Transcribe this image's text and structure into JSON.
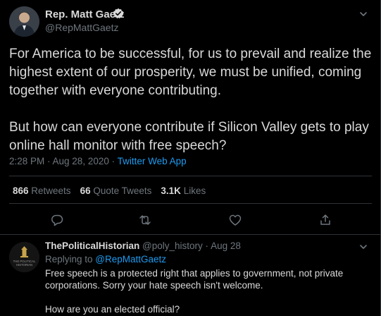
{
  "tweet": {
    "author_name": "Rep. Matt Gaetz",
    "author_handle": "@RepMattGaetz",
    "paragraphs": [
      "For America to be successful, for us to prevail and realize the highest extent of our prosperity, we must be unified, coming together with everyone contributing.",
      "But how can everyone contribute if Silicon Valley gets to play online hall monitor with free speech?"
    ],
    "timestamp": "2:28 PM · Aug 28, 2020 · ",
    "source": "Twitter Web App",
    "stats": {
      "retweets_count": "866",
      "retweets_label": " Retweets",
      "quotes_count": "66",
      "quotes_label": " Quote Tweets",
      "likes_count": "3.1K",
      "likes_label": " Likes"
    }
  },
  "reply": {
    "author_name": "ThePoliticalHistorian",
    "author_handle": "@poly_history",
    "date": "Aug 28",
    "replying_prefix": "Replying to ",
    "replying_to": "@RepMattGaetz",
    "avatar_text": "THE POLITICAL HISTORIAN",
    "paragraphs": [
      "Free speech is a protected right that applies to government, not private corporations. Sorry your hate speech isn't welcome.",
      "How are you an elected official?"
    ]
  },
  "icons": {
    "verified": "verified-badge-icon",
    "more": "chevron-down-icon",
    "reply": "comment-icon",
    "retweet": "retweet-icon",
    "like": "heart-icon",
    "share": "share-icon"
  },
  "colors": {
    "background": "#000000",
    "text": "#d9d9d9",
    "muted": "#6e767d",
    "accent": "#1d9bf0",
    "divider": "#2f3336"
  }
}
